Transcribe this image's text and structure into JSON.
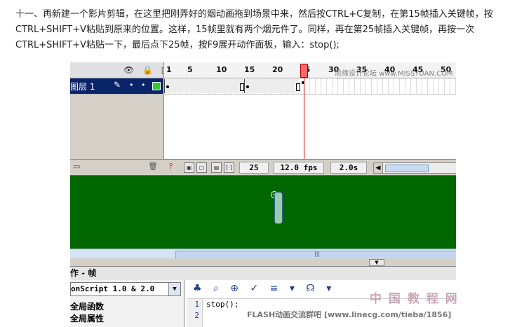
{
  "instruction": {
    "text": "十一、再新建一个影片剪辑，在这里把刚弄好的烟动画拖到场景中来，然后按CTRL+C复制，在第15帧插入关键帧，按CTRL+SHIFT+V粘贴到原来的位置。这样，15帧里就有两个烟元件了。同样，再在第25帧插入关键帧，再按一次CTRL+SHIFT+V粘贴一下，最后点下25帧，按F9展开动作面板，输入：stop();"
  },
  "timeline": {
    "header_icons": "👁 🔒 □",
    "ruler": [
      "1",
      "5",
      "10",
      "15",
      "20",
      "25",
      "30",
      "35",
      "40",
      "45",
      "50"
    ],
    "layer": {
      "name": "图层 1",
      "pencil_icon": "✎",
      "dot1": "•",
      "dot2": "•"
    },
    "status": {
      "current_frame": "25",
      "fps": "12.0 fps",
      "time": "2.0s",
      "scroll_left_arrow": "◀"
    },
    "keyframes": [
      1,
      14,
      15,
      24,
      25
    ]
  },
  "stage": {
    "background": "#006600",
    "scroll_grip": "|||"
  },
  "actions_panel": {
    "title": "作 - 帧",
    "version_select": "onScript 1.0 & 2.0",
    "dropdown_arrow": "▼",
    "categories": [
      "全局函数",
      "全局属性"
    ],
    "toolbar_icons": "♣ ⌕ ⊕ ✓ ≡ ▾ ☊ ▾",
    "line_numbers": [
      "1",
      "2"
    ],
    "code": [
      "stop();",
      ""
    ]
  },
  "watermarks": {
    "top": "思缘设计论坛 www.MISSYUAN.COM",
    "bottom": "FLASH动画交流群吧 [www.linecg.com/tieba/1856]",
    "logo": "中 国 教 程 网"
  }
}
